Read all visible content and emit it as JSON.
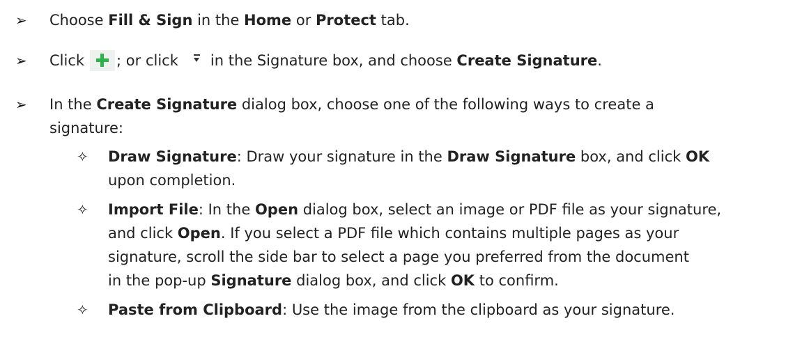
{
  "bullets": {
    "level1": "➢",
    "level2": "✧"
  },
  "step1": {
    "text1": "Choose ",
    "b1": "Fill & Sign",
    "text2": " in the ",
    "b2": "Home",
    "text3": " or ",
    "b3": "Protect",
    "text4": " tab."
  },
  "step2": {
    "text1": "Click",
    "text2": "; or click",
    "text3": "in the Signature box, and choose ",
    "b1": "Create Signature",
    "text4": ".",
    "plus_icon": "plus-icon",
    "dropdown_icon": "dropdown-icon"
  },
  "step3": {
    "text1": "In the ",
    "b1": "Create Signature",
    "text2": " dialog box, choose one of the following ways to create a",
    "line2": "signature:"
  },
  "sub1": {
    "b1": "Draw Signature",
    "text1": ": Draw your signature in the ",
    "b2": "Draw Signature",
    "text2": " box, and click ",
    "b3": "OK",
    "line2": "upon completion."
  },
  "sub2": {
    "b1": "Import File",
    "text1": ": In the ",
    "b2": "Open",
    "text2": " dialog box, select an image or PDF file as your signature,",
    "l2_text1": "and click ",
    "l2_b1": "Open",
    "l2_text2": ". If you select a PDF file which contains multiple pages as your",
    "line3": "signature, scroll the side bar to select a page you preferred from the document",
    "l4_text1": "in the pop-up ",
    "l4_b1": "Signature",
    "l4_text2": " dialog box, and click ",
    "l4_b2": "OK",
    "l4_text3": " to confirm."
  },
  "sub3": {
    "b1": "Paste from Clipboard",
    "text1": ": Use the image from the clipboard as your signature."
  }
}
